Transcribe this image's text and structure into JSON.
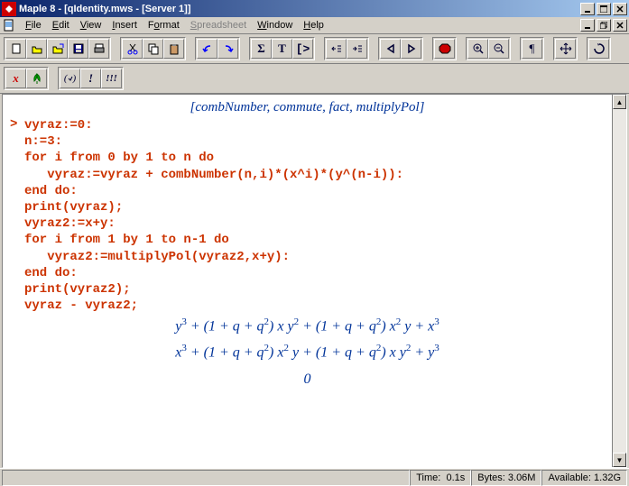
{
  "title": "Maple 8  - [qIdentity.mws - [Server 1]]",
  "menus": {
    "file": "File",
    "edit": "Edit",
    "view": "View",
    "insert": "Insert",
    "format": "Format",
    "spreadsheet": "Spreadsheet",
    "window": "Window",
    "help": "Help"
  },
  "output": {
    "header": "[combNumber, commute, fact, multiplyPol]",
    "math1": "y³ + (1 + q + q²) x y² + (1 + q + q²) x² y + x³",
    "math2": "x³ + (1 + q + q²) x² y + (1 + q + q²) x y² + y³",
    "math3": "0"
  },
  "code": {
    "l1": "vyraz:=0:",
    "l2": "n:=3:",
    "l3": "for i from 0 by 1 to n do",
    "l4": "   vyraz:=vyraz + combNumber(n,i)*(x^i)*(y^(n-i)):",
    "l5": "end do:",
    "l6": "print(vyraz);",
    "l7": "",
    "l8": "vyraz2:=x+y:",
    "l9": "for i from 1 by 1 to n-1 do",
    "l10": "   vyraz2:=multiplyPol(vyraz2,x+y):",
    "l11": "end do:",
    "l12": "print(vyraz2);",
    "l13": "",
    "l14": "vyraz - vyraz2;"
  },
  "status": {
    "time_label": "Time:",
    "time_value": "0.1s",
    "bytes_label": "Bytes:",
    "bytes_value": "3.06M",
    "avail_label": "Available:",
    "avail_value": "1.32G"
  },
  "tb2": {
    "x": "x",
    "paren": "( )",
    "bang": "!",
    "bangs": "!!!"
  }
}
